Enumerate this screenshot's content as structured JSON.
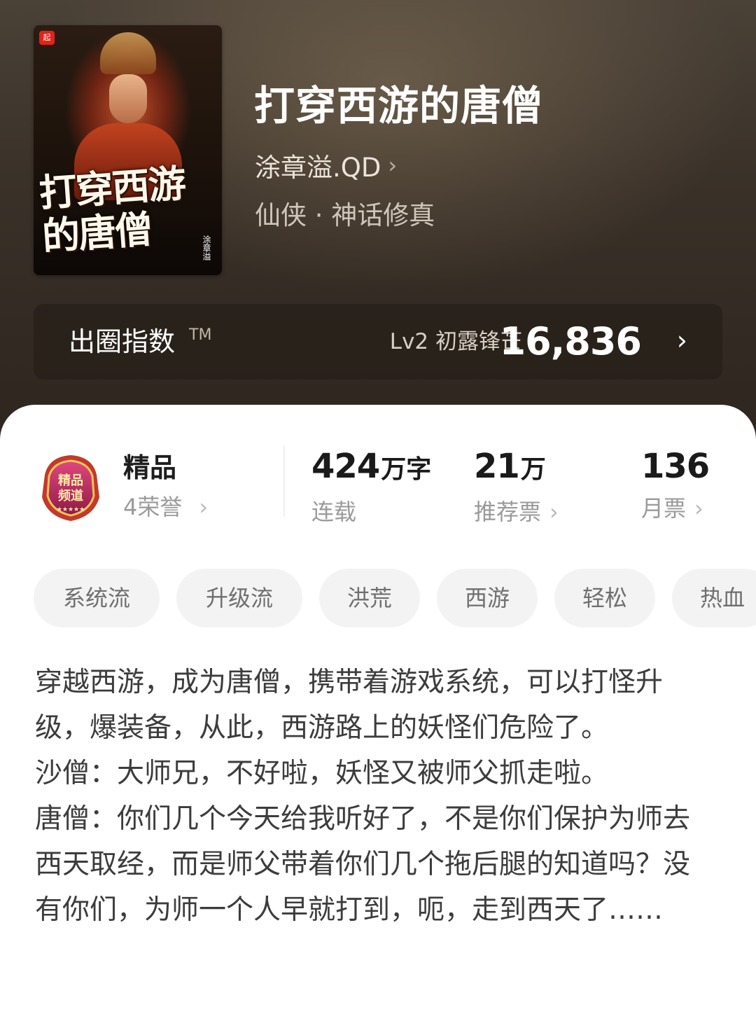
{
  "book": {
    "title": "打穿西游的唐僧",
    "author": "涂章溢.QD",
    "genre": "仙侠 · 神话修真",
    "cover": {
      "title_text": "打穿西游的唐僧",
      "author_text": "涂章溢",
      "logo": "起"
    }
  },
  "index": {
    "label": "出圈指数",
    "tm": "TM",
    "level": "Lv2 初露锋芒",
    "score": "16,836"
  },
  "stats": {
    "premium": {
      "title": "精品",
      "honors": "4荣誉"
    },
    "words": {
      "number": "424",
      "unit": "万字",
      "label": "连载"
    },
    "recommend": {
      "number": "21",
      "unit": "万",
      "label": "推荐票"
    },
    "monthly": {
      "number": "136",
      "label": "月票"
    }
  },
  "tags": [
    "系统流",
    "升级流",
    "洪荒",
    "西游",
    "轻松",
    "热血"
  ],
  "description": "穿越西游，成为唐僧，携带着游戏系统，可以打怪升级，爆装备，从此，西游路上的妖怪们危险了。\n沙僧：大师兄，不好啦，妖怪又被师父抓走啦。\n唐僧：你们几个今天给我听好了，不是你们保护为师去西天取经，而是师父带着你们几个拖后腿的知道吗？没有你们，为师一个人早就打到，呃，走到西天了……",
  "icons": {
    "chevron": "chevron-right-icon",
    "badge": "premium-channel-badge-icon"
  },
  "colors": {
    "hero_bg": "#3a3129",
    "accent_badge": "#c2185b"
  }
}
